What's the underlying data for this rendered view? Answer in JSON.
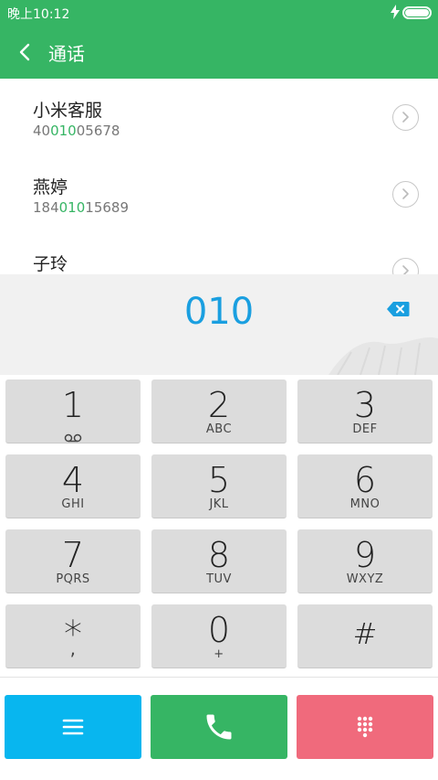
{
  "status_bar": {
    "time": "晚上10:12",
    "charging_icon": "bolt-icon",
    "battery_icon": "battery-icon"
  },
  "app_bar": {
    "title": "通话",
    "back_icon": "chevron-left-icon"
  },
  "contacts": [
    {
      "name": "小米客服",
      "number_pre": "40",
      "number_match": "010",
      "number_post": "05678"
    },
    {
      "name": "燕婷",
      "number_pre": "184",
      "number_match": "010",
      "number_post": "15689"
    },
    {
      "name": "子玲",
      "number_pre": "",
      "number_match": "",
      "number_post": ""
    }
  ],
  "dial_input": {
    "digits": "010",
    "delete_icon": "backspace-icon"
  },
  "keypad": [
    {
      "digit": "1",
      "letters": ""
    },
    {
      "digit": "2",
      "letters": "ABC"
    },
    {
      "digit": "3",
      "letters": "DEF"
    },
    {
      "digit": "4",
      "letters": "GHI"
    },
    {
      "digit": "5",
      "letters": "JKL"
    },
    {
      "digit": "6",
      "letters": "MNO"
    },
    {
      "digit": "7",
      "letters": "PQRS"
    },
    {
      "digit": "8",
      "letters": "TUV"
    },
    {
      "digit": "9",
      "letters": "WXYZ"
    },
    {
      "digit": "*",
      "letters": ","
    },
    {
      "digit": "0",
      "letters": "+"
    },
    {
      "digit": "#",
      "letters": ""
    }
  ],
  "actions": {
    "menu_icon": "menu-icon",
    "call_icon": "phone-icon",
    "dialpad_icon": "dialpad-icon"
  },
  "colors": {
    "brand_green": "#36b564",
    "accent_blue": "#1a9fe0",
    "menu_blue": "#08b6ef",
    "dialpad_pink": "#f06a7c"
  }
}
